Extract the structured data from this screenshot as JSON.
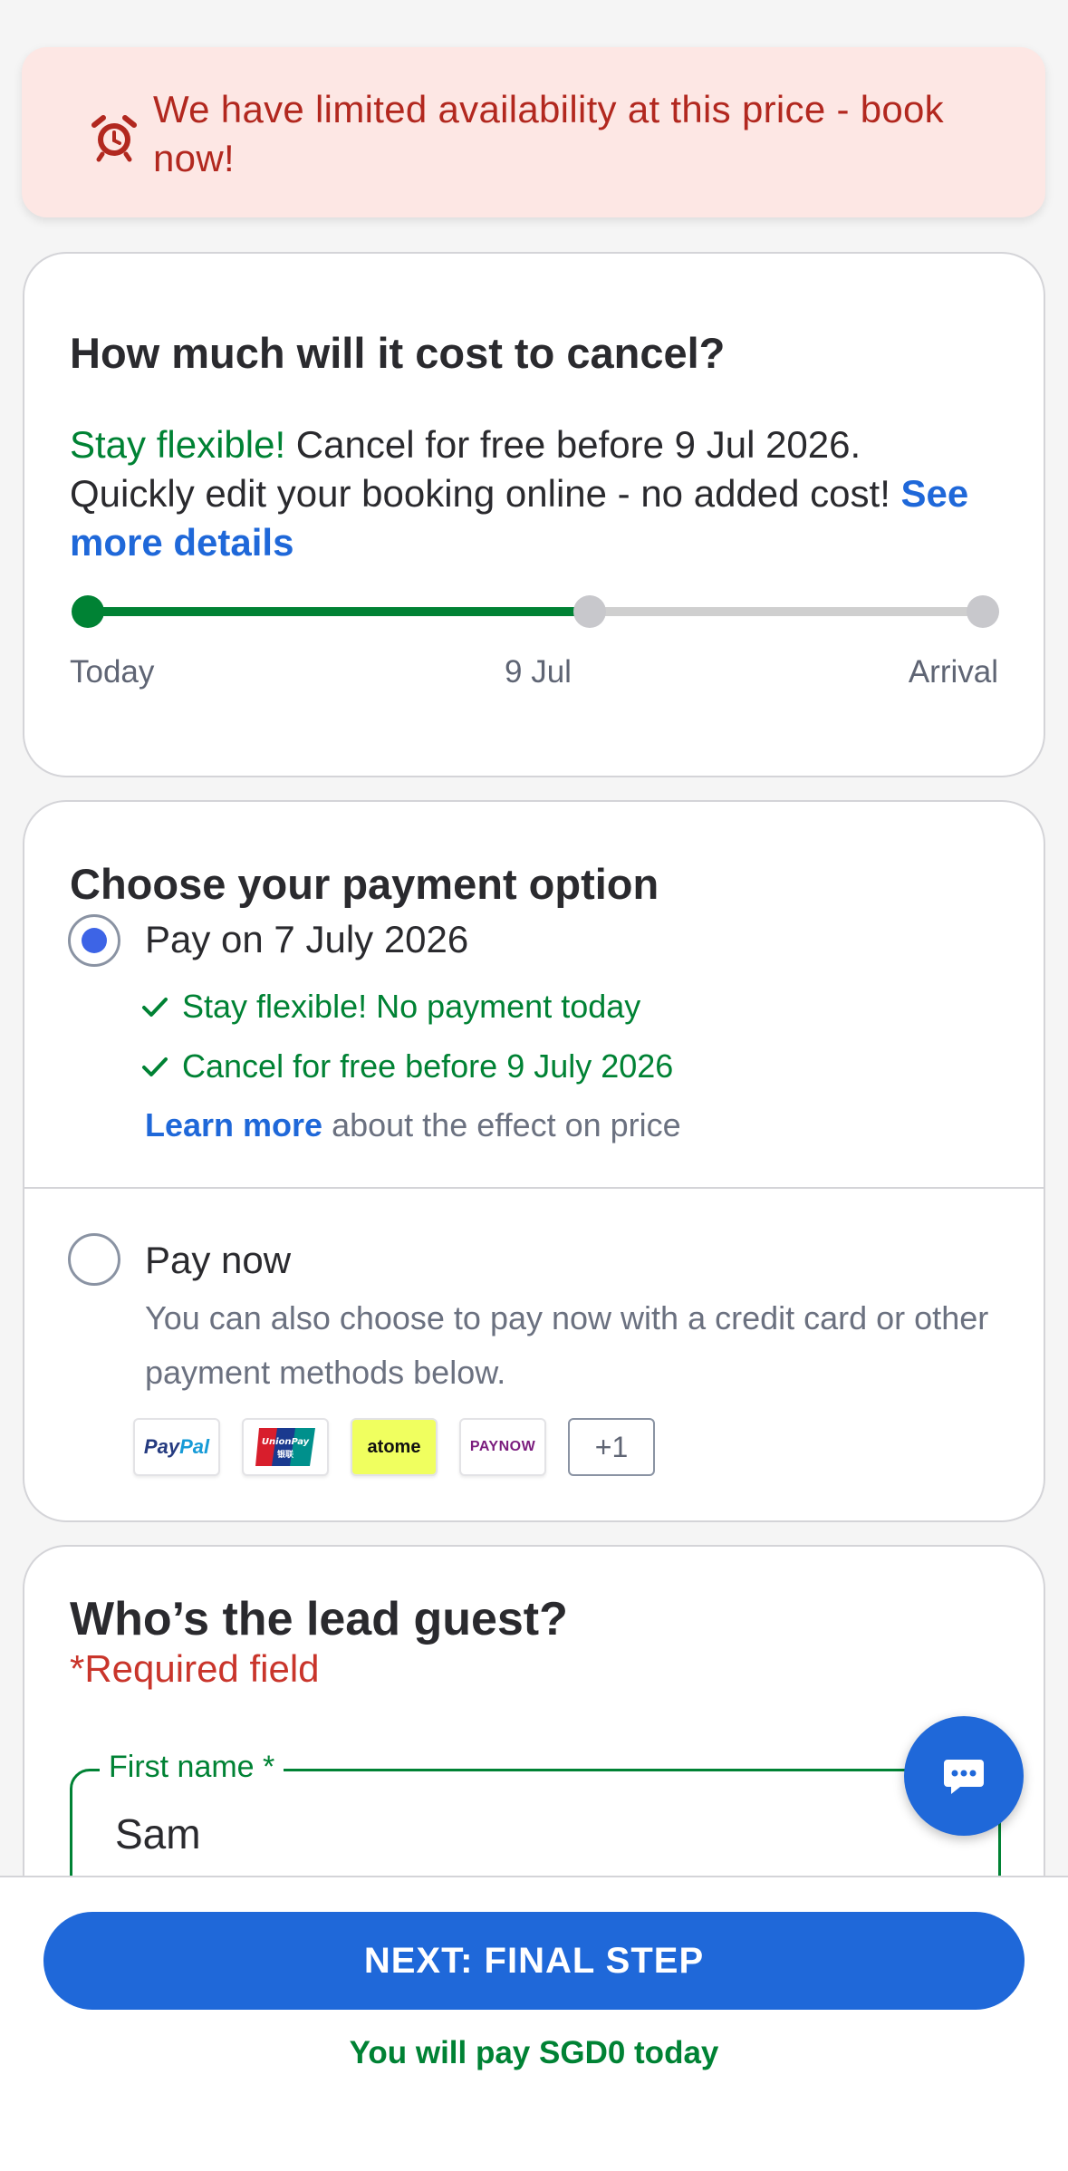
{
  "alert": {
    "text": "We have limited availability at this price - book now!",
    "icon": "alarm-clock-icon"
  },
  "cancellation": {
    "title": "How much will it cost to cancel?",
    "flex_text": "Stay flexible!",
    "desc_text": " Cancel for free before 9 Jul 2026. Quickly edit your booking online - no added cost! ",
    "details_link": "See more details",
    "timeline": {
      "labels": [
        "Today",
        "9 Jul",
        "Arrival"
      ],
      "progress_fraction": 0.56
    }
  },
  "payment": {
    "title": "Choose your payment option",
    "options": [
      {
        "label": "Pay on 7 July 2026",
        "selected": true,
        "benefits": [
          "Stay flexible! No payment today",
          "Cancel for free before 9 July 2026"
        ],
        "learn_link": "Learn more",
        "learn_suffix": " about the effect on price"
      },
      {
        "label": "Pay now",
        "selected": false,
        "description": "You can also choose to pay now with a credit card or other payment methods below."
      }
    ],
    "methods": [
      "PayPal",
      "UnionPay",
      "atome",
      "PAYNOW",
      "+1"
    ]
  },
  "guest": {
    "title": "Who’s the lead guest?",
    "required_note": "*Required field",
    "first_name_label": "First name *",
    "first_name_value": "Sam"
  },
  "footer": {
    "next_button": "NEXT: FINAL STEP",
    "pay_today": "You will pay SGD0 today"
  },
  "colors": {
    "brand_blue": "#1f68d9",
    "success_green": "#008234",
    "alert_red": "#b2281f",
    "alert_bg": "#fde7e4"
  }
}
